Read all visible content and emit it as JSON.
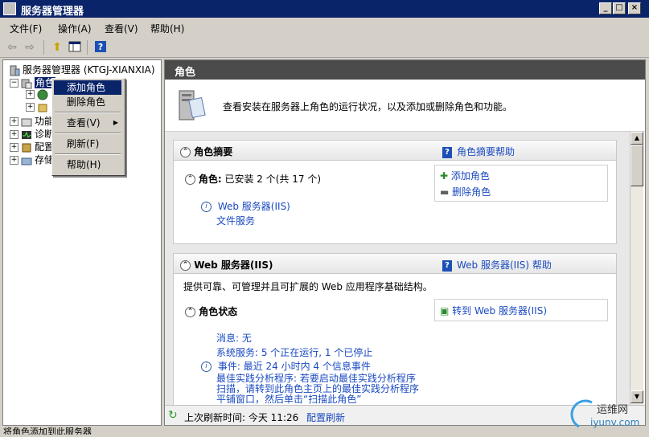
{
  "window": {
    "title": "服务器管理器"
  },
  "menu": [
    "文件(F)",
    "操作(A)",
    "查看(V)",
    "帮助(H)"
  ],
  "tree": {
    "root": "服务器管理器 (KTGJ-XIANXIA)",
    "roles": "角色",
    "features": "功能",
    "diagnostics": "诊断",
    "config": "配置",
    "storage": "存储"
  },
  "context_menu": {
    "add_role": "添加角色",
    "remove_role": "删除角色",
    "view": "查看(V)",
    "refresh": "刷新(F)",
    "help": "帮助(H)"
  },
  "pane": {
    "header": "角色",
    "intro": "查看安装在服务器上角色的运行状况，以及添加或删除角色和功能。",
    "summary": {
      "title": "角色摘要",
      "help": "角色摘要帮助",
      "roles_label": "角色:",
      "roles_status": "已安装 2 个(共 17 个)",
      "role_items": [
        "Web 服务器(IIS)",
        "文件服务"
      ],
      "actions": [
        "添加角色",
        "删除角色"
      ]
    },
    "web": {
      "title": "Web 服务器(IIS)",
      "help": "Web 服务器(IIS) 帮助",
      "desc": "提供可靠、可管理并且可扩展的 Web 应用程序基础结构。",
      "status_title": "角色状态",
      "goto": "转到 Web 服务器(IIS)",
      "messages": "消息: 无",
      "services": "系统服务: 5 个正在运行, 1 个已停止",
      "events": "事件: 最近 24 小时内 4 个信息事件",
      "bpa_1": "最佳实践分析程序: 若要启动最佳实践分析程序",
      "bpa_2": "扫描，请转到此角色主页上的最佳实践分析程序",
      "bpa_3": "平铺窗口，然后单击“扫描此角色”"
    },
    "refresh": {
      "label": "上次刷新时间: 今天 11:26",
      "link": "配置刷新"
    }
  },
  "status": {
    "text": "将角色添加到此服务器"
  },
  "watermark": {
    "cn": "运维网",
    "en": "iyunv.com"
  }
}
